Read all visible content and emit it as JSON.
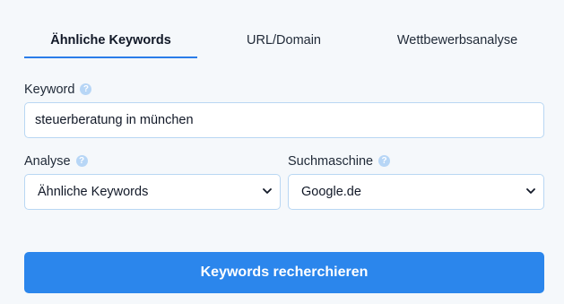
{
  "tabs": [
    {
      "label": "Ähnliche Keywords",
      "active": true
    },
    {
      "label": "URL/Domain",
      "active": false
    },
    {
      "label": "Wettbewerbsanalyse",
      "active": false
    }
  ],
  "keyword": {
    "label": "Keyword",
    "help": "?",
    "value": "steuerberatung in münchen"
  },
  "analyse": {
    "label": "Analyse",
    "help": "?",
    "selected": "Ähnliche Keywords"
  },
  "suchmaschine": {
    "label": "Suchmaschine",
    "help": "?",
    "selected": "Google.de"
  },
  "submit_label": "Keywords recherchieren",
  "colors": {
    "accent": "#2b86ec",
    "field_border": "#b9d7f3",
    "help_icon": "#b7d6f6",
    "background": "#f5f8fb"
  },
  "icons": {
    "help": "help-circle-icon",
    "select": "chevron-down-icon"
  }
}
